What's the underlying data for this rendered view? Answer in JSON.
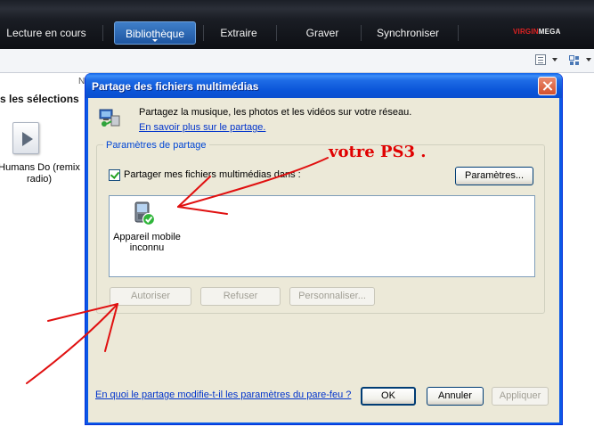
{
  "wmp": {
    "tabs": [
      {
        "label": "Lecture en cours"
      },
      {
        "label": "Bibliothèque"
      },
      {
        "label": "Extraire"
      },
      {
        "label": "Graver"
      },
      {
        "label": "Synchroniser"
      }
    ],
    "active_tab": "Bibliothèque",
    "brand": {
      "part1": "VIRGIN",
      "part2": "MEGA"
    },
    "column_header_fragment": "N"
  },
  "left_pane": {
    "header": "s les sélections",
    "track": {
      "line1": "Humans Do (remix",
      "line2": "radio)"
    }
  },
  "dialog": {
    "title": "Partage des fichiers multimédias",
    "intro_text": "Partagez la musique, les photos et les vidéos sur votre réseau.",
    "learn_more_link": "En savoir plus sur le partage.",
    "group_label": "Paramètres de partage",
    "share_checkbox": {
      "label": "Partager mes fichiers multimédias dans :",
      "checked": true
    },
    "settings_button": "Paramètres...",
    "device": {
      "line1": "Appareil mobile",
      "line2": "inconnu"
    },
    "action_buttons": {
      "allow": "Autoriser",
      "deny": "Refuser",
      "customize": "Personnaliser..."
    },
    "firewall_link": "En quoi le partage modifie-t-il les paramètres du pare-feu ?",
    "footer_buttons": {
      "ok": "OK",
      "cancel": "Annuler",
      "apply": "Appliquer"
    }
  },
  "annotation": {
    "text": "votre PS3 .",
    "color": "#e00000"
  },
  "colors": {
    "title_bar": "#0a54d8",
    "link": "#0033cc",
    "group_label": "#0046d5",
    "dialog_bg": "#ece9d8"
  }
}
